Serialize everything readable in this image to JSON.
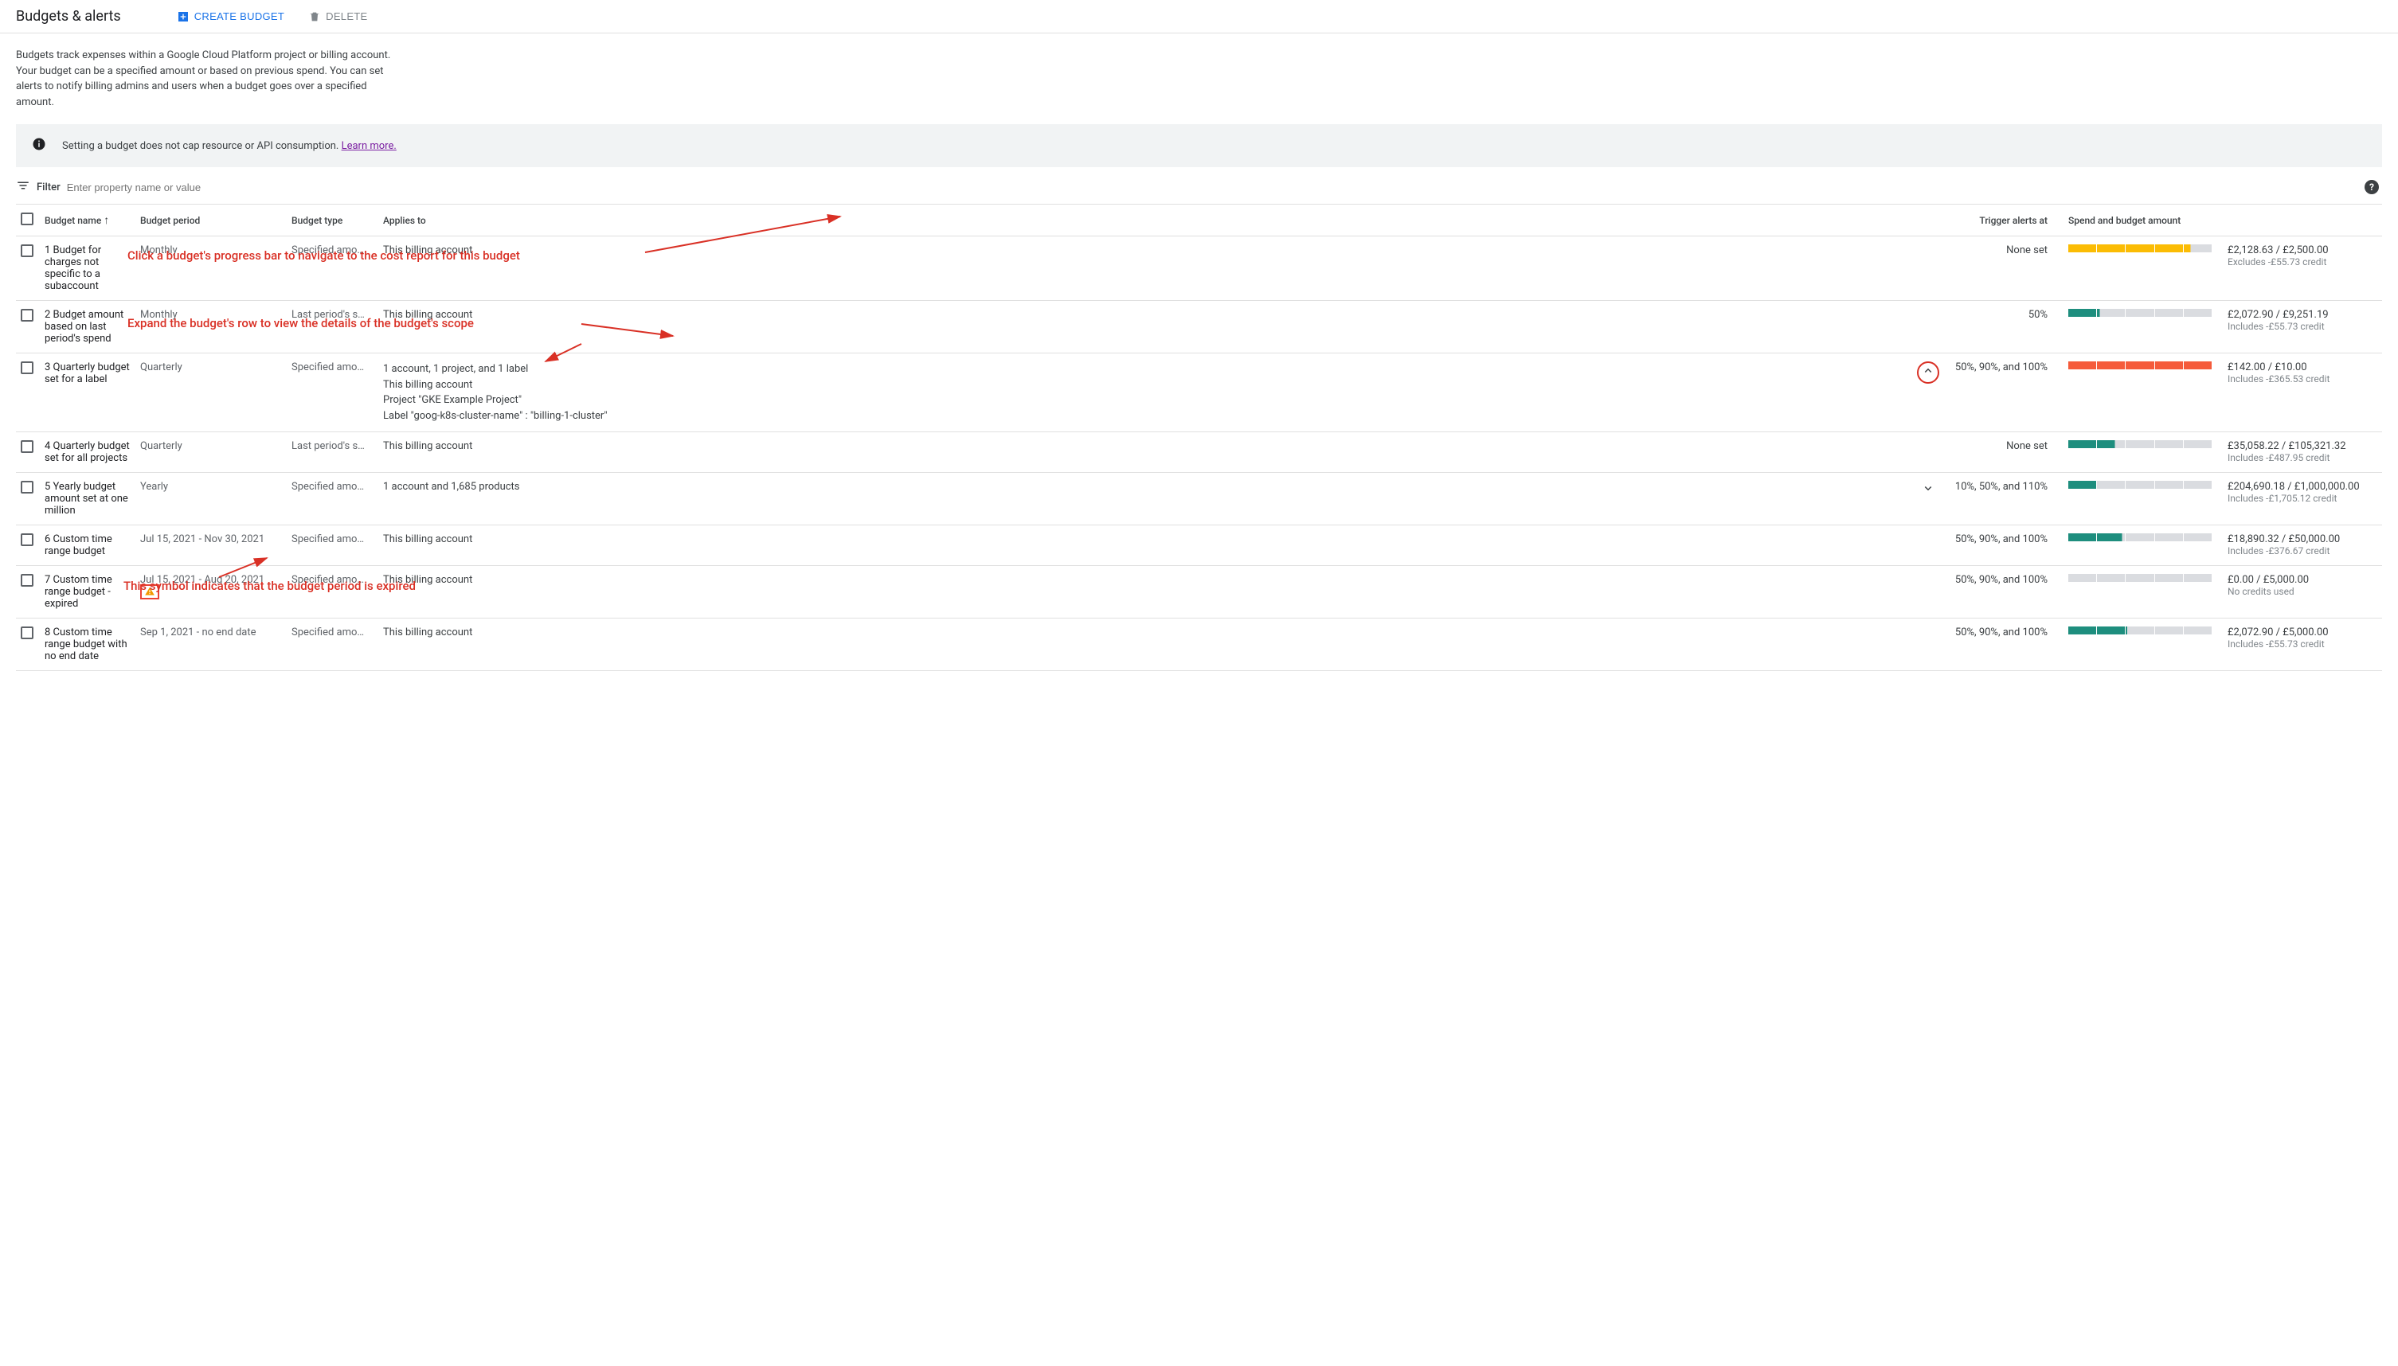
{
  "header": {
    "title": "Budgets & alerts",
    "create_label": "CREATE BUDGET",
    "delete_label": "DELETE"
  },
  "intro": "Budgets track expenses within a Google Cloud Platform project or billing account. Your budget can be a specified amount or based on previous spend. You can set alerts to notify billing admins and users when a budget goes over a specified amount.",
  "banner": {
    "text": "Setting a budget does not cap resource or API consumption. ",
    "link": "Learn more."
  },
  "filter": {
    "label": "Filter",
    "placeholder": "Enter property name or value"
  },
  "columns": {
    "name": "Budget name",
    "period": "Budget period",
    "type": "Budget type",
    "applies": "Applies to",
    "alerts": "Trigger alerts at",
    "spend": "Spend and budget amount"
  },
  "rows": [
    {
      "name": "1 Budget for charges not specific to a subaccount",
      "period": "Monthly",
      "type": "Specified amo…",
      "applies": "This billing account",
      "expand": "",
      "alerts": "None set",
      "bar": {
        "color": "yellow",
        "fill": 0.85
      },
      "amount": "£2,128.63 / £2,500.00",
      "sub": "Excludes -£55.73 credit"
    },
    {
      "name": "2 Budget amount based on last period's spend",
      "period": "Monthly",
      "type": "Last period's s…",
      "applies": "This billing account",
      "expand": "",
      "alerts": "50%",
      "bar": {
        "color": "teal",
        "fill": 0.22
      },
      "amount": "£2,072.90 / £9,251.19",
      "sub": "Includes -£55.73 credit"
    },
    {
      "name": "3 Quarterly budget set for a label",
      "period": "Quarterly",
      "type": "Specified amo…",
      "applies_lines": [
        "1 account, 1 project, and 1 label",
        "This billing account",
        "Project \"GKE Example Project\"",
        "Label \"goog-k8s-cluster-name\" : \"billing-1-cluster\""
      ],
      "expand": "up",
      "alerts": "50%, 90%, and 100%",
      "bar": {
        "color": "orange",
        "fill": 1.0
      },
      "amount": "£142.00 / £10.00",
      "sub": "Includes -£365.53 credit"
    },
    {
      "name": "4 Quarterly budget set for all projects",
      "period": "Quarterly",
      "type": "Last period's s…",
      "applies": "This billing account",
      "expand": "",
      "alerts": "None set",
      "bar": {
        "color": "teal",
        "fill": 0.33
      },
      "amount": "£35,058.22 / £105,321.32",
      "sub": "Includes -£487.95 credit"
    },
    {
      "name": "5 Yearly budget amount set at one million",
      "period": "Yearly",
      "type": "Specified amo…",
      "applies": "1 account and 1,685 products",
      "expand": "down",
      "alerts": "10%, 50%, and 110%",
      "bar": {
        "color": "teal",
        "fill": 0.2
      },
      "amount": "£204,690.18 / £1,000,000.00",
      "sub": "Includes -£1,705.12 credit"
    },
    {
      "name": "6 Custom time range budget",
      "period": "Jul 15, 2021 - Nov 30, 2021",
      "type": "Specified amo…",
      "applies": "This billing account",
      "expand": "",
      "alerts": "50%, 90%, and 100%",
      "bar": {
        "color": "teal",
        "fill": 0.38
      },
      "amount": "£18,890.32 / £50,000.00",
      "sub": "Includes -£376.67 credit"
    },
    {
      "name": "7 Custom time range budget - expired",
      "period": "Jul 15, 2021 - Aug 20, 2021",
      "period_warn": true,
      "type": "Specified amo…",
      "applies": "This billing account",
      "expand": "",
      "alerts": "50%, 90%, and 100%",
      "bar": {
        "color": "grey",
        "fill": 0.0
      },
      "amount": "£0.00 / £5,000.00",
      "sub": "No credits used"
    },
    {
      "name": "8 Custom time range budget with no end date",
      "period": "Sep 1, 2021 - no end date",
      "type": "Specified amo…",
      "applies": "This billing account",
      "expand": "",
      "alerts": "50%, 90%, and 100%",
      "bar": {
        "color": "teal",
        "fill": 0.41
      },
      "amount": "£2,072.90 / £5,000.00",
      "sub": "Includes -£55.73 credit"
    }
  ],
  "annotations": {
    "a1": "Click a budget's progress bar to navigate to the cost report for this budget",
    "a2": "Expand the budget's row to view the details of the budget's scope",
    "a3": "This symbol indicates that the budget period is expired"
  }
}
